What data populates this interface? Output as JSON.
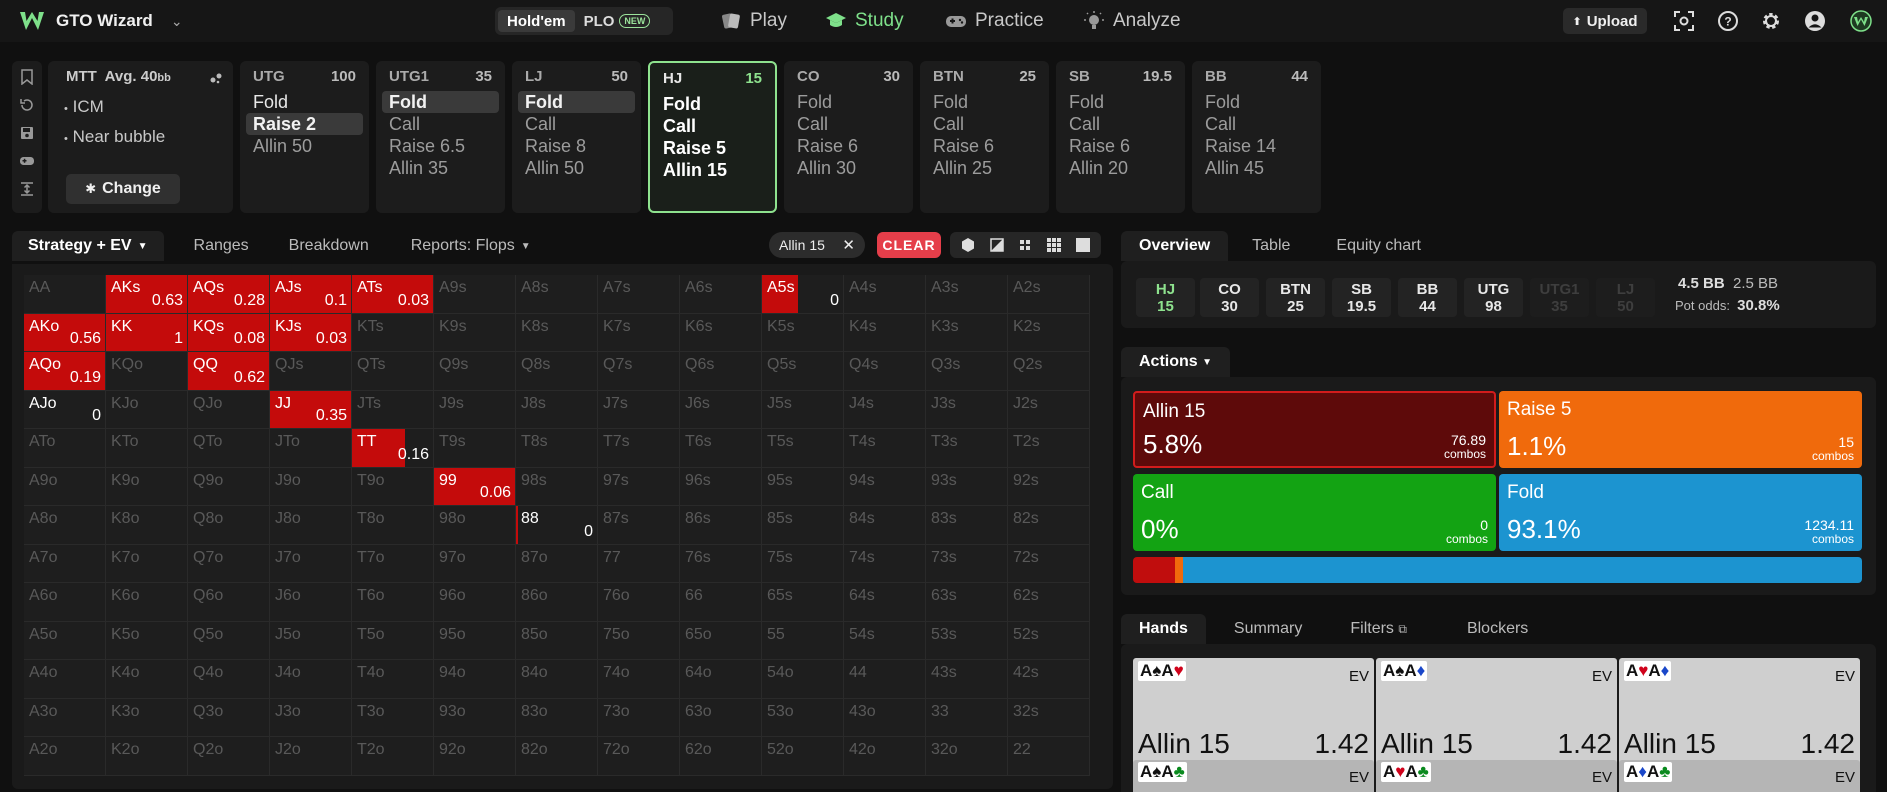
{
  "topbar": {
    "app_name": "GTO Wizard",
    "game_holdem": "Hold'em",
    "game_plo": "PLO",
    "new_badge": "NEW",
    "nav": [
      {
        "label": "Play",
        "icon": "cards-icon"
      },
      {
        "label": "Study",
        "icon": "graduation-cap-icon"
      },
      {
        "label": "Practice",
        "icon": "gamepad-icon"
      },
      {
        "label": "Analyze",
        "icon": "lightbulb-icon"
      }
    ],
    "upload_label": "Upload",
    "accent": "#7ee08a"
  },
  "spot": {
    "format": "MTT",
    "avg_label": "Avg. 40",
    "avg_unit": "bb",
    "tags": [
      "ICM",
      "Near bubble"
    ],
    "change_label": "Change"
  },
  "positions": [
    {
      "name": "UTG",
      "stack": "100",
      "actions": [
        "Fold",
        "Raise 2",
        "Allin 50"
      ],
      "highlight": 1
    },
    {
      "name": "UTG1",
      "stack": "35",
      "actions": [
        "Fold",
        "Call",
        "Raise 6.5",
        "Allin 35"
      ],
      "highlight": 0
    },
    {
      "name": "LJ",
      "stack": "50",
      "actions": [
        "Fold",
        "Call",
        "Raise 8",
        "Allin 50"
      ],
      "highlight": 0
    },
    {
      "name": "HJ",
      "stack": "15",
      "actions": [
        "Fold",
        "Call",
        "Raise 5",
        "Allin 15"
      ],
      "highlight": -1
    },
    {
      "name": "CO",
      "stack": "30",
      "actions": [
        "Fold",
        "Call",
        "Raise 6",
        "Allin 30"
      ],
      "highlight": -1
    },
    {
      "name": "BTN",
      "stack": "25",
      "actions": [
        "Fold",
        "Call",
        "Raise 6",
        "Allin 25"
      ],
      "highlight": -1
    },
    {
      "name": "SB",
      "stack": "19.5",
      "actions": [
        "Fold",
        "Call",
        "Raise 6",
        "Allin 20"
      ],
      "highlight": -1
    },
    {
      "name": "BB",
      "stack": "44",
      "actions": [
        "Fold",
        "Call",
        "Raise 14",
        "Allin 45"
      ],
      "highlight": -1
    }
  ],
  "strategy_tabs": {
    "strategy": "Strategy + EV",
    "ranges": "Ranges",
    "breakdown": "Breakdown",
    "reports": "Reports: Flops"
  },
  "filter_chip": "Allin 15",
  "clear_label": "CLEAR",
  "matrix": {
    "ranks": [
      "A",
      "K",
      "Q",
      "J",
      "T",
      "9",
      "8",
      "7",
      "6",
      "5",
      "4",
      "3",
      "2"
    ],
    "cells": {
      "AKs": {
        "f": 1,
        "ev": "0.63"
      },
      "AQs": {
        "f": 1,
        "ev": "0.28"
      },
      "AJs": {
        "f": 1,
        "ev": "0.1"
      },
      "ATs": {
        "f": 1,
        "ev": "0.03"
      },
      "A5s": {
        "f": 0.45,
        "ev": "0"
      },
      "AKo": {
        "f": 1,
        "ev": "0.56"
      },
      "KK": {
        "f": 1,
        "ev": "1"
      },
      "KQs": {
        "f": 1,
        "ev": "0.08"
      },
      "KJs": {
        "f": 1,
        "ev": "0.03"
      },
      "AQo": {
        "f": 1,
        "ev": "0.19"
      },
      "QQ": {
        "f": 1,
        "ev": "0.62"
      },
      "AJo": {
        "f": 0,
        "ev": "0"
      },
      "JJ": {
        "f": 1,
        "ev": "0.35"
      },
      "TT": {
        "f": 0.65,
        "ev": "0.16"
      },
      "99": {
        "f": 1,
        "ev": "0.06"
      },
      "88": {
        "f": 0.03,
        "ev": "0"
      }
    }
  },
  "right_tabs": {
    "overview": "Overview",
    "table": "Table",
    "equity": "Equity chart"
  },
  "seats": [
    {
      "name": "HJ",
      "stack": "15"
    },
    {
      "name": "CO",
      "stack": "30"
    },
    {
      "name": "BTN",
      "stack": "25"
    },
    {
      "name": "SB",
      "stack": "19.5"
    },
    {
      "name": "BB",
      "stack": "44"
    },
    {
      "name": "UTG",
      "stack": "98"
    },
    {
      "name": "UTG1",
      "stack": "35"
    },
    {
      "name": "LJ",
      "stack": "50"
    }
  ],
  "pot": {
    "pot_bb": "4.5 BB",
    "call_bb": "2.5 BB",
    "odds_label": "Pot odds:",
    "odds_value": "30.8%"
  },
  "actions_label": "Actions",
  "actions": [
    {
      "name": "Allin 15",
      "pct": "5.8%",
      "combos": "76.89",
      "color": "#5e0a0a",
      "freq": 5.8
    },
    {
      "name": "Raise 5",
      "pct": "1.1%",
      "combos": "15",
      "color": "#f06a0c",
      "freq": 1.1
    },
    {
      "name": "Call",
      "pct": "0%",
      "combos": "0",
      "color": "#13a313",
      "freq": 0
    },
    {
      "name": "Fold",
      "pct": "93.1%",
      "combos": "1234.11",
      "color": "#1c94d0",
      "freq": 93.1
    }
  ],
  "combos_label": "combos",
  "hands_tabs": {
    "hands": "Hands",
    "summary": "Summary",
    "filters": "Filters",
    "blockers": "Blockers"
  },
  "hand_cards": [
    {
      "c1": "A",
      "s1": "♠",
      "k1": "k",
      "c2": "A",
      "s2": "♥",
      "k2": "r",
      "action": "Allin 15",
      "ev": "1.42"
    },
    {
      "c1": "A",
      "s1": "♠",
      "k1": "k",
      "c2": "A",
      "s2": "♦",
      "k2": "b",
      "action": "Allin 15",
      "ev": "1.42"
    },
    {
      "c1": "A",
      "s1": "♥",
      "k1": "r",
      "c2": "A",
      "s2": "♦",
      "k2": "b",
      "action": "Allin 15",
      "ev": "1.42"
    }
  ],
  "hand_cards_row2": [
    {
      "c1": "A",
      "s1": "♠",
      "k1": "k",
      "c2": "A",
      "s2": "♣",
      "k2": "g"
    },
    {
      "c1": "A",
      "s1": "♥",
      "k1": "r",
      "c2": "A",
      "s2": "♣",
      "k2": "g"
    },
    {
      "c1": "A",
      "s1": "♦",
      "k1": "b",
      "c2": "A",
      "s2": "♣",
      "k2": "g"
    }
  ],
  "ev_label": "EV"
}
